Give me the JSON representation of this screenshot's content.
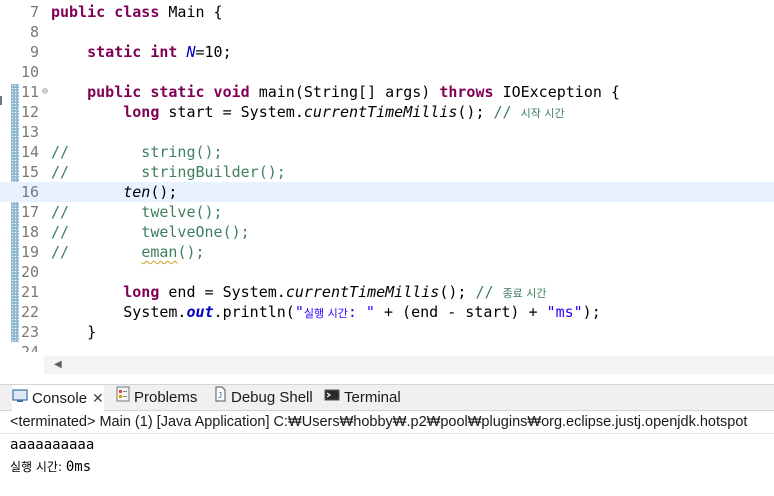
{
  "editor": {
    "lines": [
      {
        "n": "7",
        "fold": "",
        "parts": [
          [
            "kw",
            "public class "
          ],
          [
            "",
            "Main {"
          ]
        ]
      },
      {
        "n": "8",
        "fold": "",
        "parts": []
      },
      {
        "n": "9",
        "fold": "",
        "parts": [
          [
            "",
            "    "
          ],
          [
            "kw",
            "static int "
          ],
          [
            "field",
            "N"
          ],
          [
            "",
            "=10;"
          ]
        ]
      },
      {
        "n": "10",
        "fold": "",
        "parts": []
      },
      {
        "n": "11",
        "fold": "⊖",
        "parts": [
          [
            "",
            "    "
          ],
          [
            "kw",
            "public static void "
          ],
          [
            "",
            "main(String[] args) "
          ],
          [
            "kw",
            "throws "
          ],
          [
            "",
            "IOException {"
          ]
        ]
      },
      {
        "n": "12",
        "fold": "",
        "parts": [
          [
            "",
            "        "
          ],
          [
            "kw",
            "long "
          ],
          [
            "",
            "start = System."
          ],
          [
            "method",
            "currentTimeMillis"
          ],
          [
            "",
            "(); "
          ],
          [
            "cm",
            "// "
          ],
          [
            "cm kr",
            "시작 시간"
          ]
        ]
      },
      {
        "n": "13",
        "fold": "",
        "parts": []
      },
      {
        "n": "14",
        "fold": "",
        "parts": [
          [
            "cm",
            "//        string();"
          ]
        ]
      },
      {
        "n": "15",
        "fold": "",
        "parts": [
          [
            "cm",
            "//        stringBuilder();"
          ]
        ]
      },
      {
        "n": "16",
        "fold": "",
        "current": true,
        "parts": [
          [
            "",
            "        "
          ],
          [
            "method",
            "ten"
          ],
          [
            "",
            "();"
          ]
        ]
      },
      {
        "n": "17",
        "fold": "",
        "parts": [
          [
            "cm",
            "//        twelve();"
          ]
        ]
      },
      {
        "n": "18",
        "fold": "",
        "parts": [
          [
            "cm",
            "//        twelveOne();"
          ]
        ]
      },
      {
        "n": "19",
        "fold": "",
        "parts": [
          [
            "cm",
            "//        "
          ],
          [
            "cm squig",
            "eman"
          ],
          [
            "cm",
            "();"
          ]
        ]
      },
      {
        "n": "20",
        "fold": "",
        "parts": []
      },
      {
        "n": "21",
        "fold": "",
        "parts": [
          [
            "",
            "        "
          ],
          [
            "kw",
            "long "
          ],
          [
            "",
            "end = System."
          ],
          [
            "method",
            "currentTimeMillis"
          ],
          [
            "",
            "(); "
          ],
          [
            "cm",
            "// "
          ],
          [
            "cm kr",
            "종료 시간"
          ]
        ]
      },
      {
        "n": "22",
        "fold": "",
        "parts": [
          [
            "",
            "        System."
          ],
          [
            "ofield",
            "out"
          ],
          [
            "",
            ".println("
          ],
          [
            "str",
            "\""
          ],
          [
            "str kr",
            "실행 시간"
          ],
          [
            "str",
            ": \""
          ],
          [
            "",
            " + (end - start) + "
          ],
          [
            "str",
            "\"ms\""
          ],
          [
            "",
            ");"
          ]
        ]
      },
      {
        "n": "23",
        "fold": "",
        "parts": [
          [
            "",
            "    }"
          ]
        ]
      },
      {
        "n": "24",
        "fold": "",
        "parts": []
      }
    ]
  },
  "console": {
    "tabs": [
      {
        "label": "Console",
        "icon": "console-icon",
        "active": true,
        "closable": true
      },
      {
        "label": "Problems",
        "icon": "problems-icon",
        "active": false
      },
      {
        "label": "Debug Shell",
        "icon": "debug-shell-icon",
        "active": false
      },
      {
        "label": "Terminal",
        "icon": "terminal-icon",
        "active": false
      }
    ],
    "status": "<terminated> Main (1) [Java Application] C:₩Users₩hobby₩.p2₩pool₩plugins₩org.eclipse.justj.openjdk.hotspot",
    "output": [
      {
        "text": "aaaaaaaaaa",
        "kr": false
      },
      {
        "text": "실행 시간: ",
        "kr": true,
        "rest": "0ms"
      }
    ]
  },
  "colors": {
    "keyword": "#7f0055",
    "field": "#0000c0",
    "comment": "#3f7f5f",
    "string": "#2a00ff",
    "current_line": "#e8f2fe"
  }
}
